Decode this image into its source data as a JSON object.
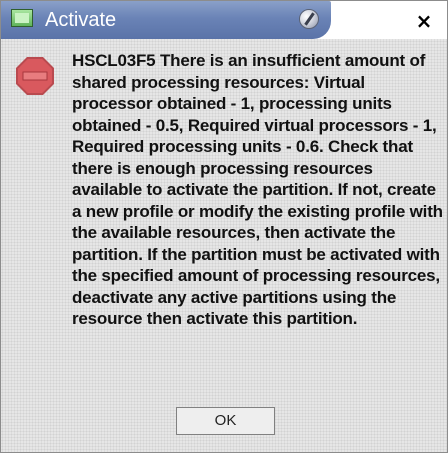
{
  "window": {
    "title": "Activate",
    "close_glyph": "×"
  },
  "icons": {
    "app": "app-window-icon",
    "title_control": "title-knob-icon",
    "message": "stop-error-icon"
  },
  "message": {
    "text": "HSCL03F5 There is an insufficient amount of shared processing resources: Virtual processor obtained - 1, processing units obtained - 0.5, Required virtual processors - 1, Required processing units - 0.6. Check that there is enough processing resources available to activate the partition. If not, create a new profile or modify the existing profile with the available resources, then activate the partition. If the partition must be activated with the specified amount of processing resources, deactivate any active partitions using the resource then activate this partition."
  },
  "buttons": {
    "ok_label": "OK"
  },
  "colors": {
    "titlebar": "#6a83b6",
    "dialog_background": "#e6e6e6",
    "stop_icon_fill": "#d9595e"
  }
}
